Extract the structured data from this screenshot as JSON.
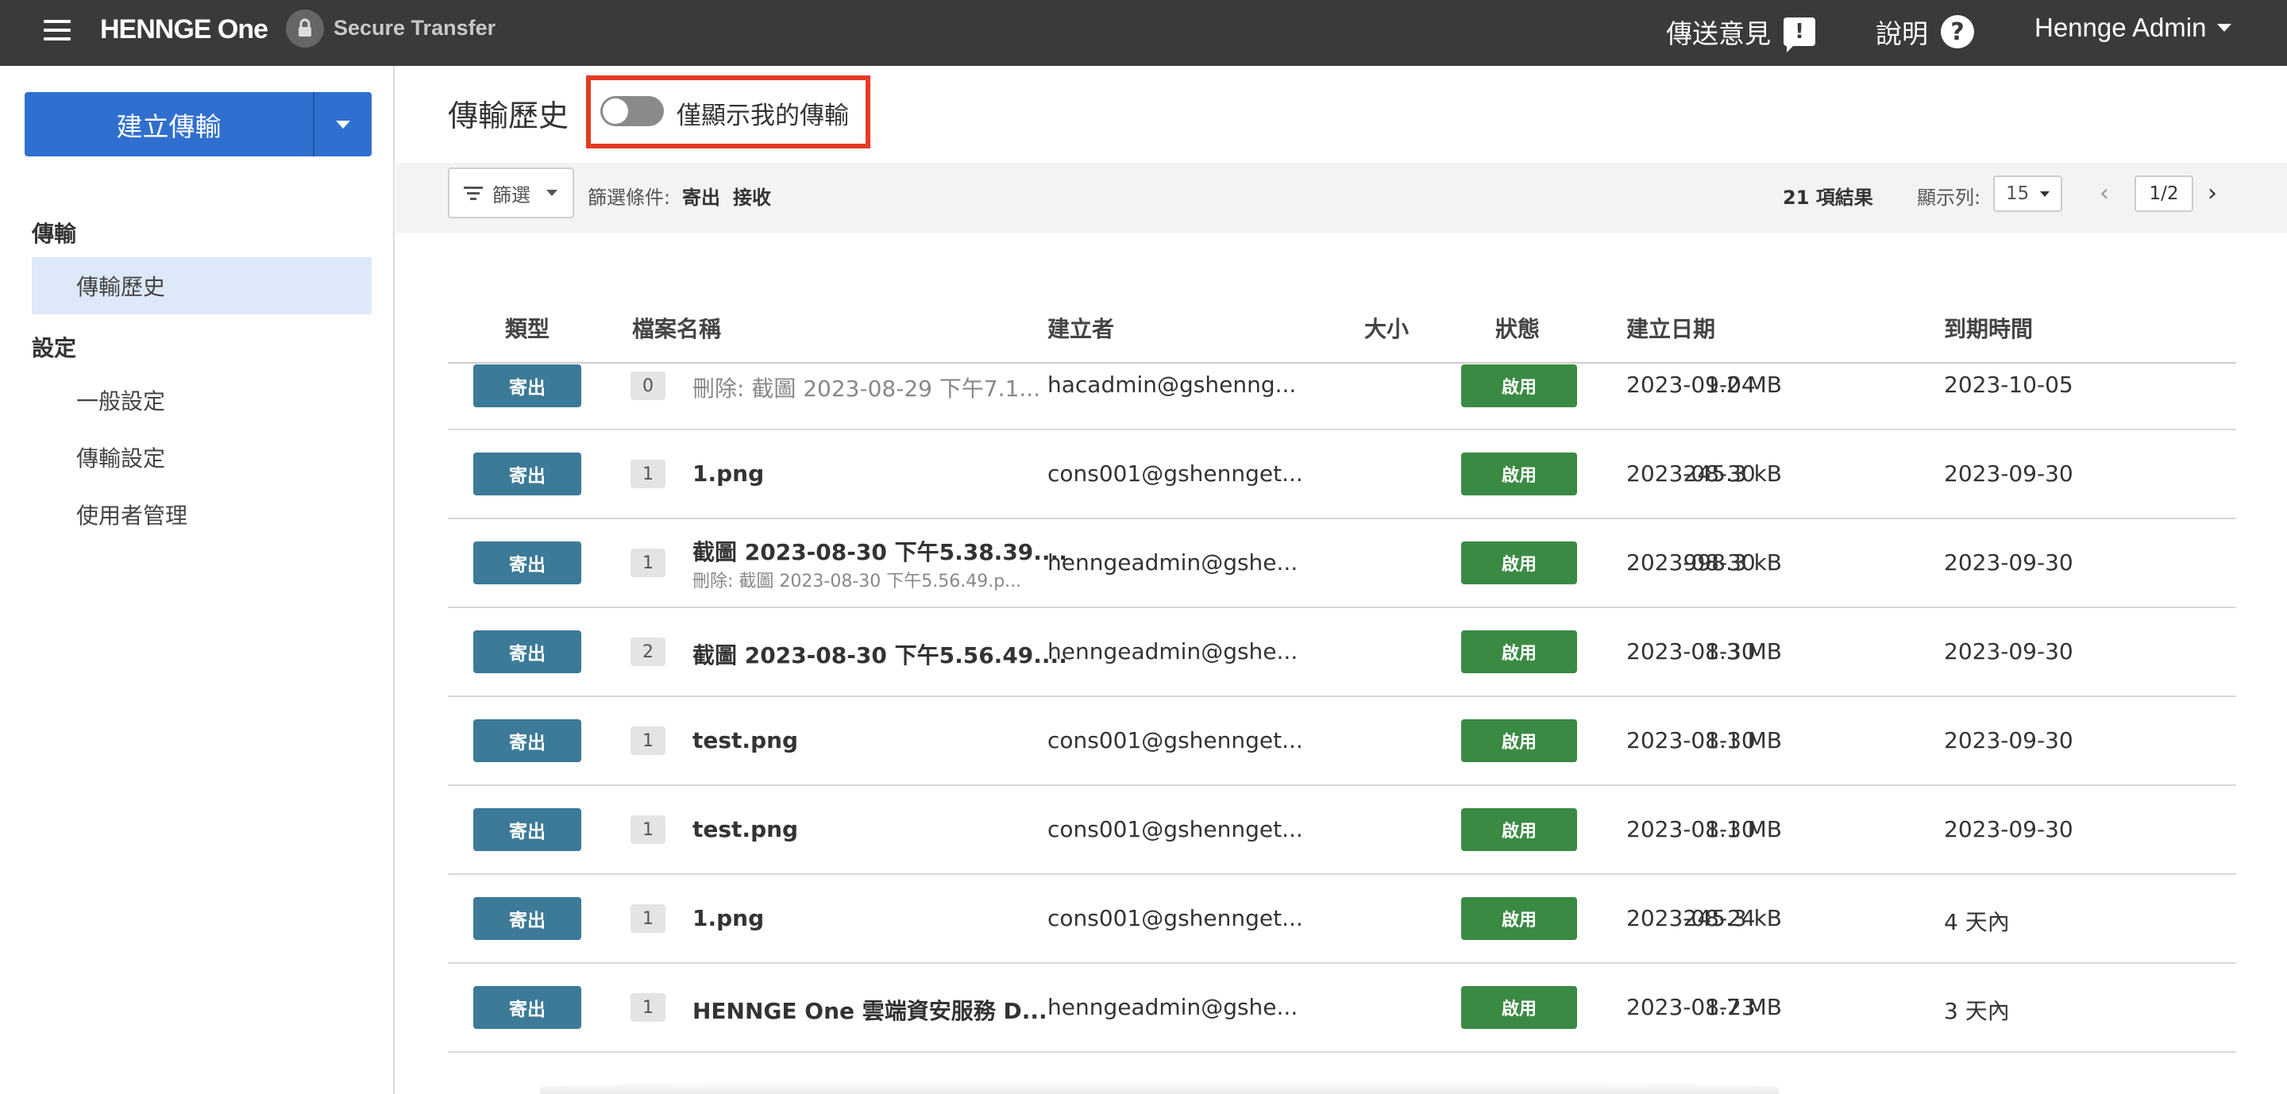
{
  "topbar": {
    "logo": "HENNGE One",
    "product": "Secure Transfer",
    "feedback_label": "傳送意見",
    "help_label": "說明",
    "user_label": "Hennge Admin"
  },
  "sidebar": {
    "create_button": "建立傳輸",
    "section_transfer": "傳輸",
    "item_history": "傳輸歷史",
    "section_settings": "設定",
    "item_general": "一般設定",
    "item_transfer_settings": "傳輸設定",
    "item_user_mgmt": "使用者管理"
  },
  "main": {
    "title": "傳輸歷史",
    "toggle_label": "僅顯示我的傳輸",
    "toggle_on": false
  },
  "filter": {
    "button_label": "篩選",
    "conditions_label": "篩選條件:",
    "tag_send": "寄出",
    "tag_receive": "接收",
    "results": "21 項結果",
    "perpage_label": "顯示列:",
    "perpage_value": "15",
    "page": "1/2"
  },
  "table": {
    "headers": {
      "type": "類型",
      "filename": "檔案名稱",
      "creator": "建立者",
      "size": "大小",
      "status": "狀態",
      "created": "建立日期",
      "expires": "到期時間"
    },
    "rows": [
      {
        "type": "寄出",
        "count": "0",
        "filename": "刪除: 截圖 2023-08-29 下午7.1...",
        "sub": "",
        "creator": "hacadmin@gshenng...",
        "size": "1.2 MB",
        "status": "啟用",
        "created": "2023-09-04",
        "expires": "2023-10-05"
      },
      {
        "type": "寄出",
        "count": "1",
        "filename": "1.png",
        "sub": "",
        "creator": "cons001@gshennget...",
        "size": "245.3 kB",
        "status": "啟用",
        "created": "2023-08-30",
        "expires": "2023-09-30"
      },
      {
        "type": "寄出",
        "count": "1",
        "filename": "截圖 2023-08-30 下午5.38.39....",
        "sub": "刪除: 截圖 2023-08-30 下午5.56.49.p...",
        "creator": "henngeadmin@gshe...",
        "size": "998.3 kB",
        "status": "啟用",
        "created": "2023-08-30",
        "expires": "2023-09-30"
      },
      {
        "type": "寄出",
        "count": "2",
        "filename": "截圖 2023-08-30 下午5.56.49....",
        "sub": "",
        "creator": "henngeadmin@gshe...",
        "size": "1.3 MB",
        "status": "啟用",
        "created": "2023-08-30",
        "expires": "2023-09-30"
      },
      {
        "type": "寄出",
        "count": "1",
        "filename": "test.png",
        "sub": "",
        "creator": "cons001@gshennget...",
        "size": "1.1 MB",
        "status": "啟用",
        "created": "2023-08-30",
        "expires": "2023-09-30"
      },
      {
        "type": "寄出",
        "count": "1",
        "filename": "test.png",
        "sub": "",
        "creator": "cons001@gshennget...",
        "size": "1.1 MB",
        "status": "啟用",
        "created": "2023-08-30",
        "expires": "2023-09-30"
      },
      {
        "type": "寄出",
        "count": "1",
        "filename": "1.png",
        "sub": "",
        "creator": "cons001@gshennget...",
        "size": "245.3 kB",
        "status": "啟用",
        "created": "2023-08-24",
        "expires": "4 天內"
      },
      {
        "type": "寄出",
        "count": "1",
        "filename": "HENNGE One 雲端資安服務 D...",
        "sub": "",
        "creator": "henngeadmin@gshe...",
        "size": "1.7 MB",
        "status": "啟用",
        "created": "2023-08-23",
        "expires": "3 天內"
      }
    ]
  }
}
